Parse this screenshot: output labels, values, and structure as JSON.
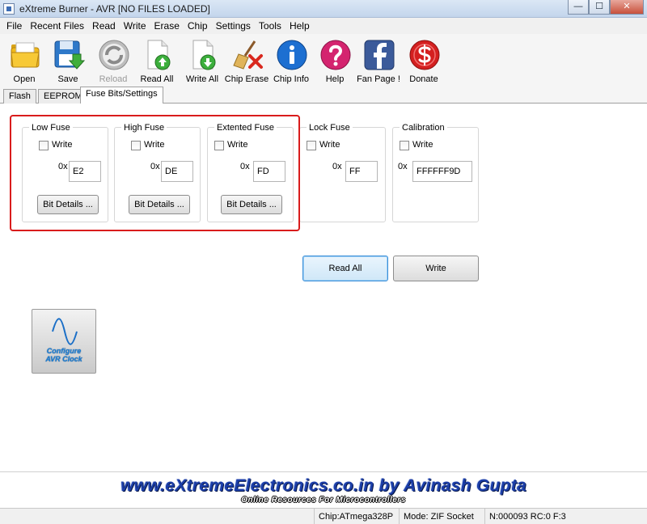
{
  "window": {
    "title": "eXtreme Burner - AVR [NO FILES LOADED]",
    "minimize_glyph": "—",
    "maximize_glyph": "☐",
    "close_glyph": "✕"
  },
  "menu": [
    {
      "label": "File"
    },
    {
      "label": "Recent Files"
    },
    {
      "label": "Read"
    },
    {
      "label": "Write"
    },
    {
      "label": "Erase"
    },
    {
      "label": "Chip"
    },
    {
      "label": "Settings"
    },
    {
      "label": "Tools"
    },
    {
      "label": "Help"
    }
  ],
  "toolbar": [
    {
      "label": "Open",
      "icon": "folder-open-icon",
      "enabled": true
    },
    {
      "label": "Save",
      "icon": "floppy-save-icon",
      "enabled": true
    },
    {
      "label": "Reload",
      "icon": "reload-icon",
      "enabled": false
    },
    {
      "label": "Read All",
      "icon": "document-read-icon",
      "enabled": true
    },
    {
      "label": "Write All",
      "icon": "document-write-icon",
      "enabled": true
    },
    {
      "label": "Chip Erase",
      "icon": "broom-erase-icon",
      "enabled": true
    },
    {
      "label": "Chip Info",
      "icon": "info-icon",
      "enabled": true
    },
    {
      "label": "Help",
      "icon": "help-icon",
      "enabled": true
    },
    {
      "label": "Fan Page !",
      "icon": "facebook-icon",
      "enabled": true
    },
    {
      "label": "Donate",
      "icon": "dollar-donate-icon",
      "enabled": true
    }
  ],
  "tabs": [
    {
      "label": "Flash",
      "active": false
    },
    {
      "label": "EEPROM",
      "active": false
    },
    {
      "label": "Fuse Bits/Settings",
      "active": true
    }
  ],
  "fuses": [
    {
      "title": "Low Fuse",
      "write_label": "Write",
      "write_checked": false,
      "prefix": "0x",
      "value": "E2",
      "button": "Bit Details ..."
    },
    {
      "title": "High Fuse",
      "write_label": "Write",
      "write_checked": false,
      "prefix": "0x",
      "value": "DE",
      "button": "Bit Details ..."
    },
    {
      "title": "Extented Fuse",
      "write_label": "Write",
      "write_checked": false,
      "prefix": "0x",
      "value": "FD",
      "button": "Bit Details ..."
    },
    {
      "title": "Lock Fuse",
      "write_label": "Write",
      "write_checked": false,
      "prefix": "0x",
      "value": "FF"
    },
    {
      "title": "Calibration",
      "write_label": "Write",
      "write_checked": false,
      "prefix": "0x",
      "value": "FFFFFF9D"
    }
  ],
  "actions": {
    "read_all": "Read All",
    "write": "Write"
  },
  "clock_button": {
    "line1": "Configure",
    "line2": "AVR Clock",
    "icon": "sine-wave-icon"
  },
  "banner": {
    "main": "www.eXtremeElectronics.co.in by Avinash Gupta",
    "sub": "Online Resources For Microcontrollers"
  },
  "status": {
    "chip": "Chip:ATmega328P",
    "mode": "Mode: ZIF Socket",
    "counter": "N:000093 RC:0 F:3"
  },
  "colors": {
    "highlight": "#d91c1c",
    "banner_text": "#1c3ea8",
    "focus_border": "#3a8ed8"
  }
}
